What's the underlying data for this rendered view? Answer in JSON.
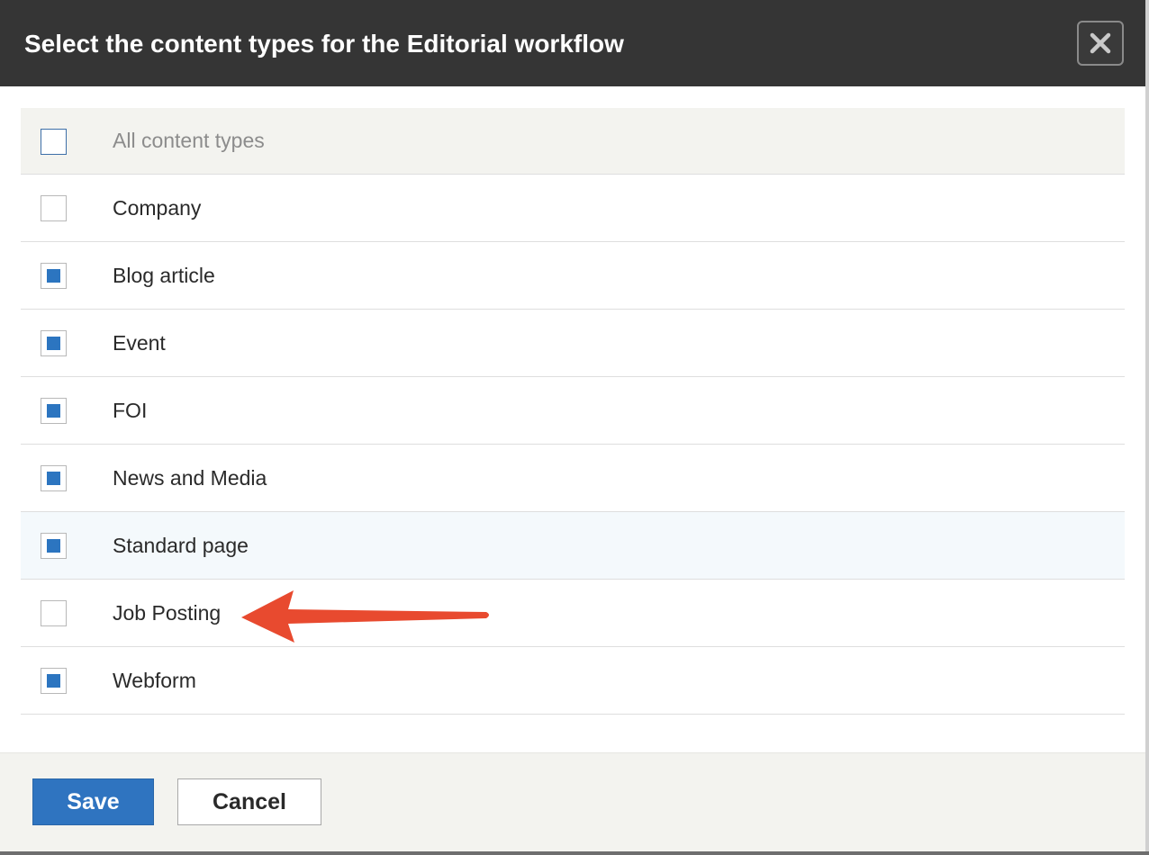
{
  "dialog": {
    "title": "Select the content types for the Editorial workflow",
    "close_icon": "close-icon"
  },
  "table": {
    "header": {
      "label": "All content types",
      "checked": false
    },
    "rows": [
      {
        "label": "Company",
        "checked": false
      },
      {
        "label": "Blog article",
        "checked": true
      },
      {
        "label": "Event",
        "checked": true
      },
      {
        "label": "FOI",
        "checked": true
      },
      {
        "label": "News and Media",
        "checked": true
      },
      {
        "label": "Standard page",
        "checked": true,
        "highlighted": true
      },
      {
        "label": "Job Posting",
        "checked": false
      },
      {
        "label": "Webform",
        "checked": true
      }
    ]
  },
  "footer": {
    "save_label": "Save",
    "cancel_label": "Cancel"
  },
  "colors": {
    "titlebar": "#353535",
    "accent": "#2f74c0",
    "annotation_arrow": "#e84a2f"
  },
  "annotation": {
    "type": "arrow",
    "icon": "arrow-left-icon",
    "points_to": "Job Posting"
  }
}
